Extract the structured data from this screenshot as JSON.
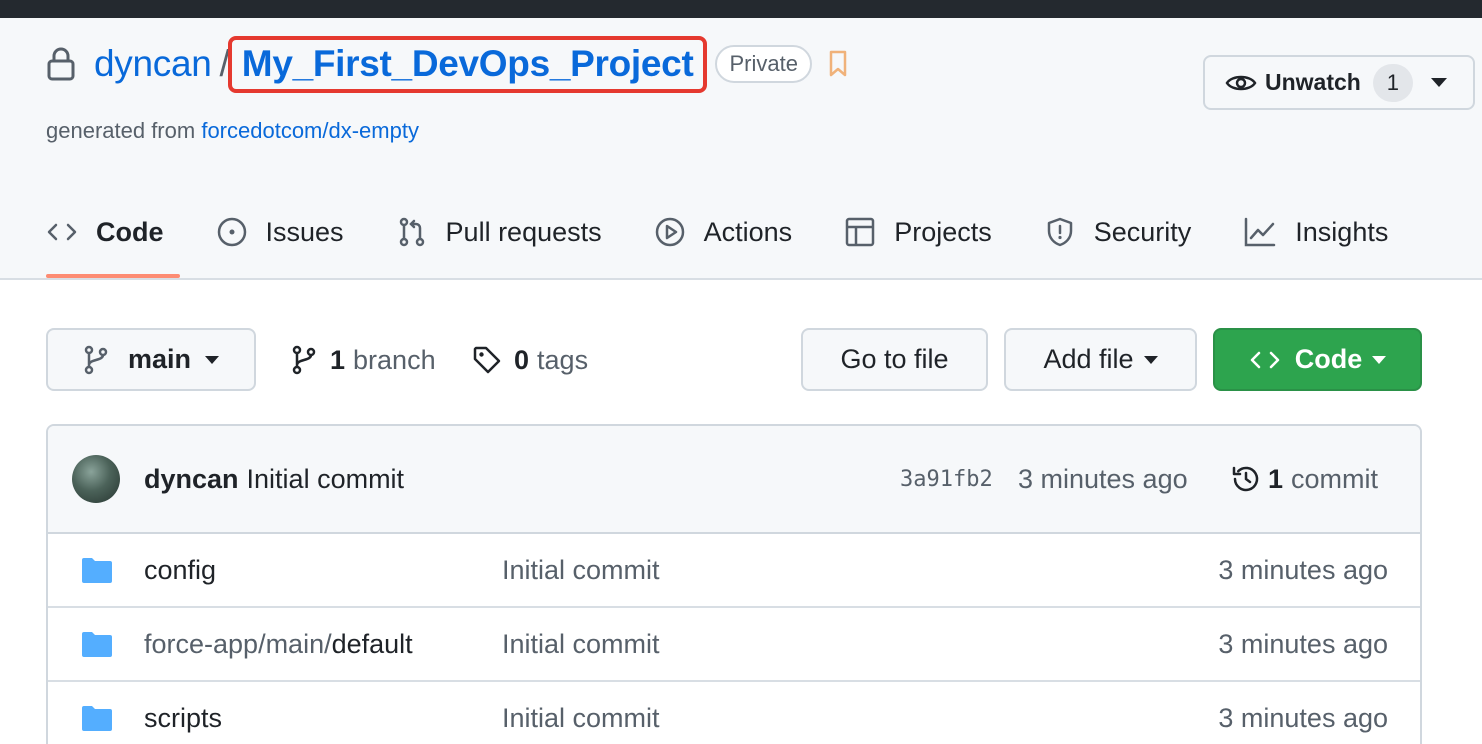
{
  "repo": {
    "owner": "dyncan",
    "separator": "/",
    "name": "My_First_DevOps_Project",
    "visibility": "Private",
    "generated_prefix": "generated from",
    "template": "forcedotcom/dx-empty"
  },
  "watch": {
    "label": "Unwatch",
    "count": "1"
  },
  "tabs": [
    {
      "label": "Code",
      "icon": "code-icon",
      "active": true
    },
    {
      "label": "Issues",
      "icon": "issue-icon"
    },
    {
      "label": "Pull requests",
      "icon": "pull-request-icon"
    },
    {
      "label": "Actions",
      "icon": "play-icon"
    },
    {
      "label": "Projects",
      "icon": "table-icon"
    },
    {
      "label": "Security",
      "icon": "shield-icon"
    },
    {
      "label": "Insights",
      "icon": "graph-icon"
    }
  ],
  "toolbar": {
    "branch": "main",
    "branch_count": "1",
    "branch_label": "branch",
    "tag_count": "0",
    "tag_label": "tags",
    "goto_file": "Go to file",
    "add_file": "Add file",
    "code": "Code"
  },
  "latest_commit": {
    "author": "dyncan",
    "message": "Initial commit",
    "sha": "3a91fb2",
    "time": "3 minutes ago",
    "count": "1",
    "count_label": "commit"
  },
  "files": [
    {
      "name_prefix": "",
      "name": "config",
      "message": "Initial commit",
      "time": "3 minutes ago"
    },
    {
      "name_prefix": "force-app/main/",
      "name": "default",
      "message": "Initial commit",
      "time": "3 minutes ago"
    },
    {
      "name_prefix": "",
      "name": "scripts",
      "message": "Initial commit",
      "time": "3 minutes ago"
    }
  ],
  "colors": {
    "link": "#0969da",
    "highlight_border": "#e5392f",
    "primary_button": "#2da44e",
    "active_tab_underline": "#fd8c73",
    "folder": "#54aeff"
  }
}
